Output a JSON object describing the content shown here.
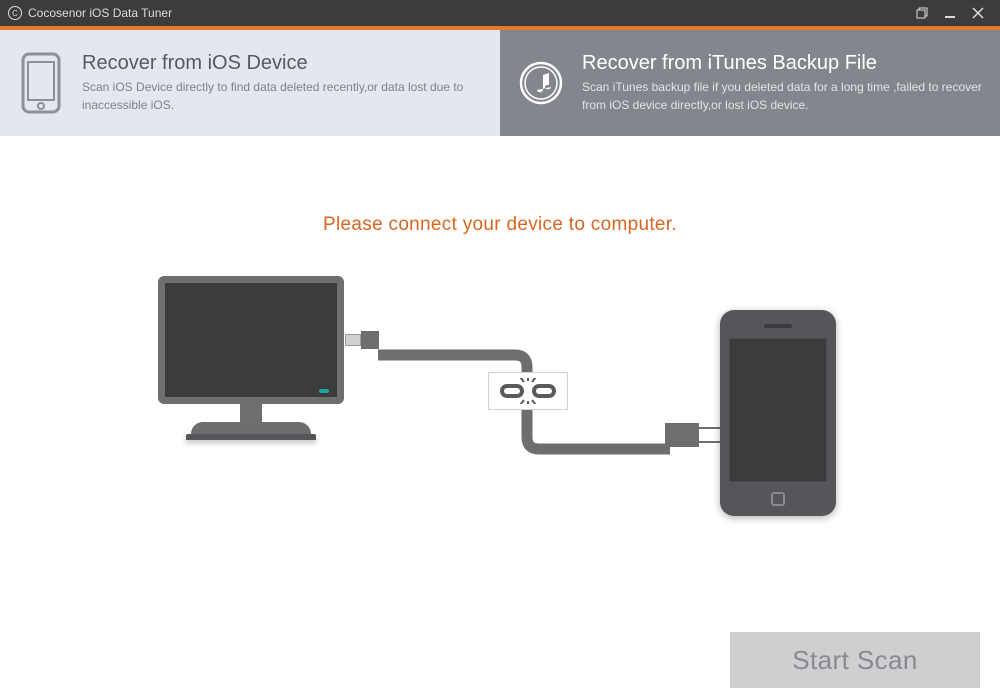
{
  "window": {
    "title": "Cocosenor iOS Data Tuner"
  },
  "colors": {
    "accent": "#e17a2d",
    "titlebar": "#3c3c3f",
    "prompt": "#d96522"
  },
  "tabs": {
    "ios_device": {
      "title": "Recover from iOS Device",
      "desc": "Scan iOS Device directly to find data deleted recently,or data lost due to inaccessible iOS.",
      "active": true
    },
    "itunes_backup": {
      "title": "Recover from iTunes Backup File",
      "desc": "Scan iTunes backup file if you deleted data for a long time ,failed to recover from iOS device directly,or lost iOS device.",
      "active": false
    }
  },
  "main": {
    "prompt": "Please connect your device to computer."
  },
  "actions": {
    "start_scan": "Start Scan",
    "start_scan_enabled": false
  }
}
